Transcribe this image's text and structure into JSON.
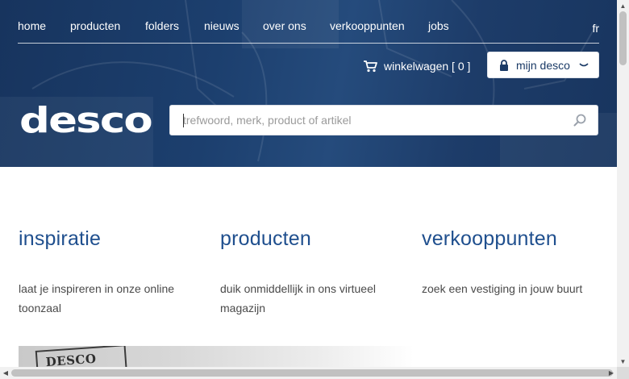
{
  "header": {
    "nav": [
      {
        "label": "home"
      },
      {
        "label": "producten"
      },
      {
        "label": "folders"
      },
      {
        "label": "nieuws"
      },
      {
        "label": "over ons"
      },
      {
        "label": "verkooppunten"
      },
      {
        "label": "jobs"
      }
    ],
    "language": "fr",
    "cart": {
      "label": "winkelwagen [ 0 ]",
      "icon": "cart-icon"
    },
    "account": {
      "label": "mijn desco",
      "icon": "lock-icon",
      "toggle_icon": "chevron-down-icon"
    },
    "logo_text": "desco",
    "search": {
      "placeholder": "trefwoord, merk, product of artikel",
      "value": "",
      "icon": "search-icon"
    }
  },
  "sections": [
    {
      "title": "inspiratie",
      "text": "laat je inspireren in onze online toonzaal"
    },
    {
      "title": "producten",
      "text": "duik onmiddellijk in ons virtueel magazijn"
    },
    {
      "title": "verkooppunten",
      "text": "zoek een vestiging in jouw buurt"
    }
  ],
  "promo": {
    "stamp_text": "DESCO"
  },
  "colors": {
    "header_bg": "#1b3a66",
    "heading": "#1f4f8e",
    "body_text": "#4a4a4a"
  }
}
